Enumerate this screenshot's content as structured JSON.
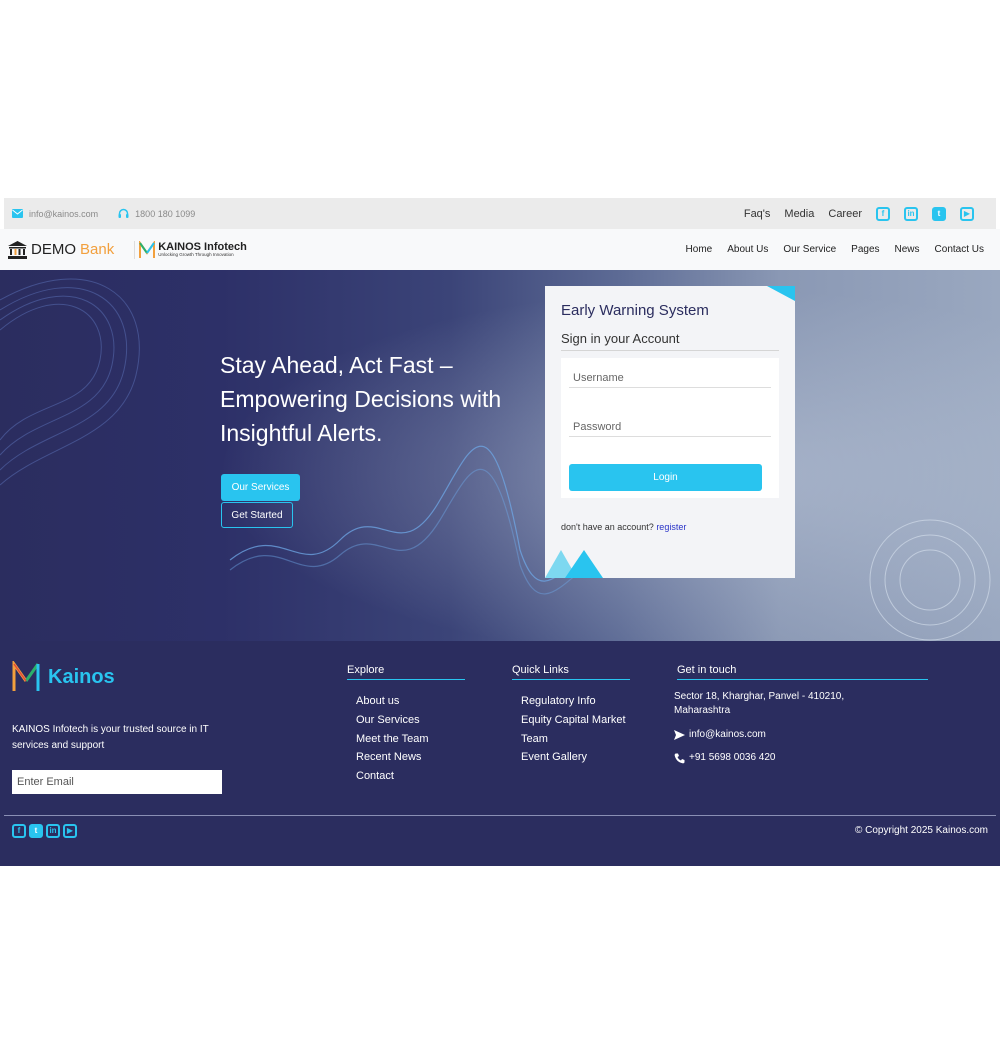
{
  "topbar": {
    "email": "info@kainos.com",
    "phone": "1800 180 1099",
    "links": [
      "Faq's",
      "Media",
      "Career"
    ],
    "social_icons": [
      "facebook-icon",
      "linkedin-icon",
      "twitter-icon",
      "youtube-icon"
    ]
  },
  "brand": {
    "demo": "DEMO",
    "bank": "Bank",
    "kainos_name": "KAINOS Infotech",
    "kainos_tagline": "Unlocking Growth Through Innovation"
  },
  "nav": {
    "items": [
      "Home",
      "About Us",
      "Our Service",
      "Pages",
      "News",
      "Contact Us"
    ]
  },
  "hero": {
    "title": "Stay Ahead, Act Fast – Empowering Decisions with Insightful Alerts.",
    "btn_services": "Our Services",
    "btn_started": "Get Started"
  },
  "login": {
    "title": "Early Warning System",
    "subtitle": "Sign in your Account",
    "username_placeholder": "Username",
    "password_placeholder": "Password",
    "login_label": "Login",
    "no_account": "don't have an account?",
    "register": "register"
  },
  "footer": {
    "logo_name": "Kainos",
    "description": "KAINOS Infotech is your trusted source in IT services and support",
    "email_placeholder": "Enter Email",
    "explore": {
      "heading": "Explore",
      "items": [
        "About us",
        "Our Services",
        "Meet the Team",
        "Recent News",
        "Contact"
      ]
    },
    "quick_links": {
      "heading": "Quick Links",
      "items": [
        "Regulatory Info",
        "Equity Capital Market",
        "Team",
        "Event Gallery"
      ]
    },
    "contact": {
      "heading": "Get in touch",
      "address": "Sector 18, Kharghar, Panvel - 410210, Maharashtra",
      "email": "info@kainos.com",
      "phone": "+91 5698 0036 420"
    },
    "copyright": "© Copyright 2025 Kainos.com"
  },
  "colors": {
    "accent": "#29c4ef",
    "navy": "#2b2d5f",
    "bank_orange": "#f2a03d"
  }
}
